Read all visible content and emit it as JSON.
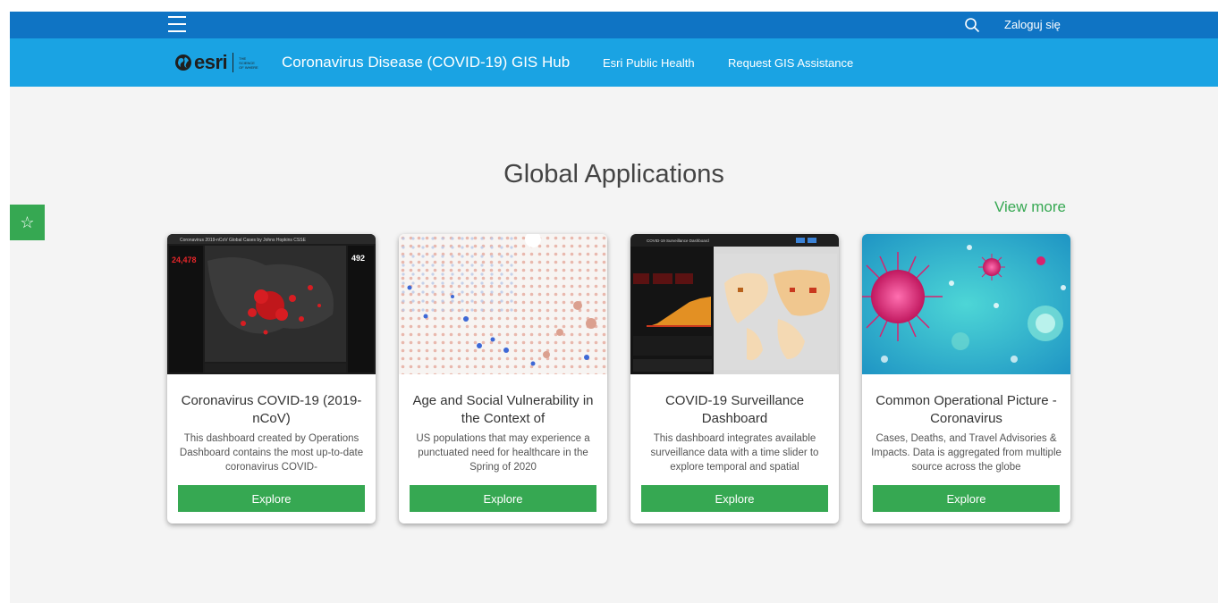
{
  "topbar": {
    "menu_icon": "hamburger-menu-icon",
    "search_icon": "search-icon",
    "signin_label": "Zaloguj się"
  },
  "navbar": {
    "logo_text": "esri",
    "logo_tagline": "THE SCIENCE OF WHERE",
    "site_title": "Coronavirus Disease (COVID-19) GIS Hub",
    "links": [
      "Esri Public Health",
      "Request GIS Assistance"
    ]
  },
  "favorite": {
    "icon": "star-icon",
    "glyph": "☆"
  },
  "main": {
    "section_title": "Global Applications",
    "view_more_label": "View more",
    "cards": [
      {
        "title": "Coronavirus COVID-19 (2019-nCoV)",
        "description": "This dashboard created by Operations Dashboard contains the most up-to-date coronavirus COVID-",
        "button_label": "Explore",
        "thumb_caption": "Coronavirus 2019-nCoV Global Cases by Johns Hopkins CSSE",
        "thumb_stat": "24,478",
        "thumb_stat_right": "492"
      },
      {
        "title": "Age and Social Vulnerability in the Context of",
        "description": "US populations that may experience a punctuated need for healthcare in the Spring of 2020",
        "button_label": "Explore"
      },
      {
        "title": "COVID-19 Surveillance Dashboard",
        "description": "This dashboard integrates available surveillance data with a time slider to explore temporal and spatial",
        "button_label": "Explore",
        "thumb_caption": "COVID-19 Surveillance Dashboard"
      },
      {
        "title": "Common Operational Picture - Coronavirus",
        "description": "Cases, Deaths, and Travel Advisories & Impacts. Data is aggregated from multiple source across the globe",
        "button_label": "Explore"
      }
    ]
  },
  "colors": {
    "topbar": "#0f74c4",
    "navbar": "#1aa3e3",
    "accent_green": "#36a852",
    "background": "#f4f4f4"
  }
}
